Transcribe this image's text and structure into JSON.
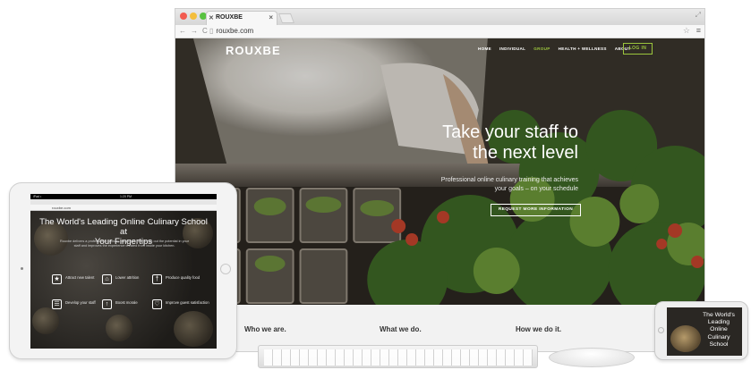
{
  "desktop": {
    "tab_title": "ROUXBE",
    "tab_close": "×",
    "url": "rouxbe.com",
    "site": {
      "logo": "ROUXBE",
      "nav": [
        "HOME",
        "INDIVIDUAL",
        "GROUP",
        "HEALTH + WELLNESS",
        "ABOUT"
      ],
      "active_nav": "GROUP",
      "login_label": "LOG IN",
      "hero_title_line1": "Take your staff to",
      "hero_title_line2": "the next level",
      "hero_sub_line1": "Professional online culinary training that achieves",
      "hero_sub_line2": "your goals – on your schedule",
      "hero_button": "REQUEST MORE INFORMATION",
      "info": [
        "Who we are.",
        "What we do.",
        "How we do it."
      ]
    }
  },
  "tablet": {
    "status_left": "iPad •",
    "time": "1:20 PM",
    "url": "rouxbe.com",
    "title_line1": "The World's Leading Online Culinary School at",
    "title_line2": "Your Fingertips",
    "sub_line1": "Rouxbe delivers a professional culinary curriculum that brings out the potential in your",
    "sub_line2": "staff and improves the experience created from inside your kitchen.",
    "features": [
      {
        "label": "Attract new talent",
        "icon": "★"
      },
      {
        "label": "Lower attrition",
        "icon": "⌂"
      },
      {
        "label": "Produce quality food",
        "icon": "†"
      },
      {
        "label": "Develop your staff",
        "icon": "☰"
      },
      {
        "label": "Boost morale",
        "icon": "↑"
      },
      {
        "label": "Improve guest satisfaction",
        "icon": "♡"
      }
    ]
  },
  "phone": {
    "title_line1": "The World's",
    "title_line2": "Leading",
    "title_line3": "Online",
    "title_line4": "Culinary",
    "title_line5": "School"
  },
  "colors": {
    "accent": "#9bc53d",
    "hero_dark": "#28251f"
  }
}
